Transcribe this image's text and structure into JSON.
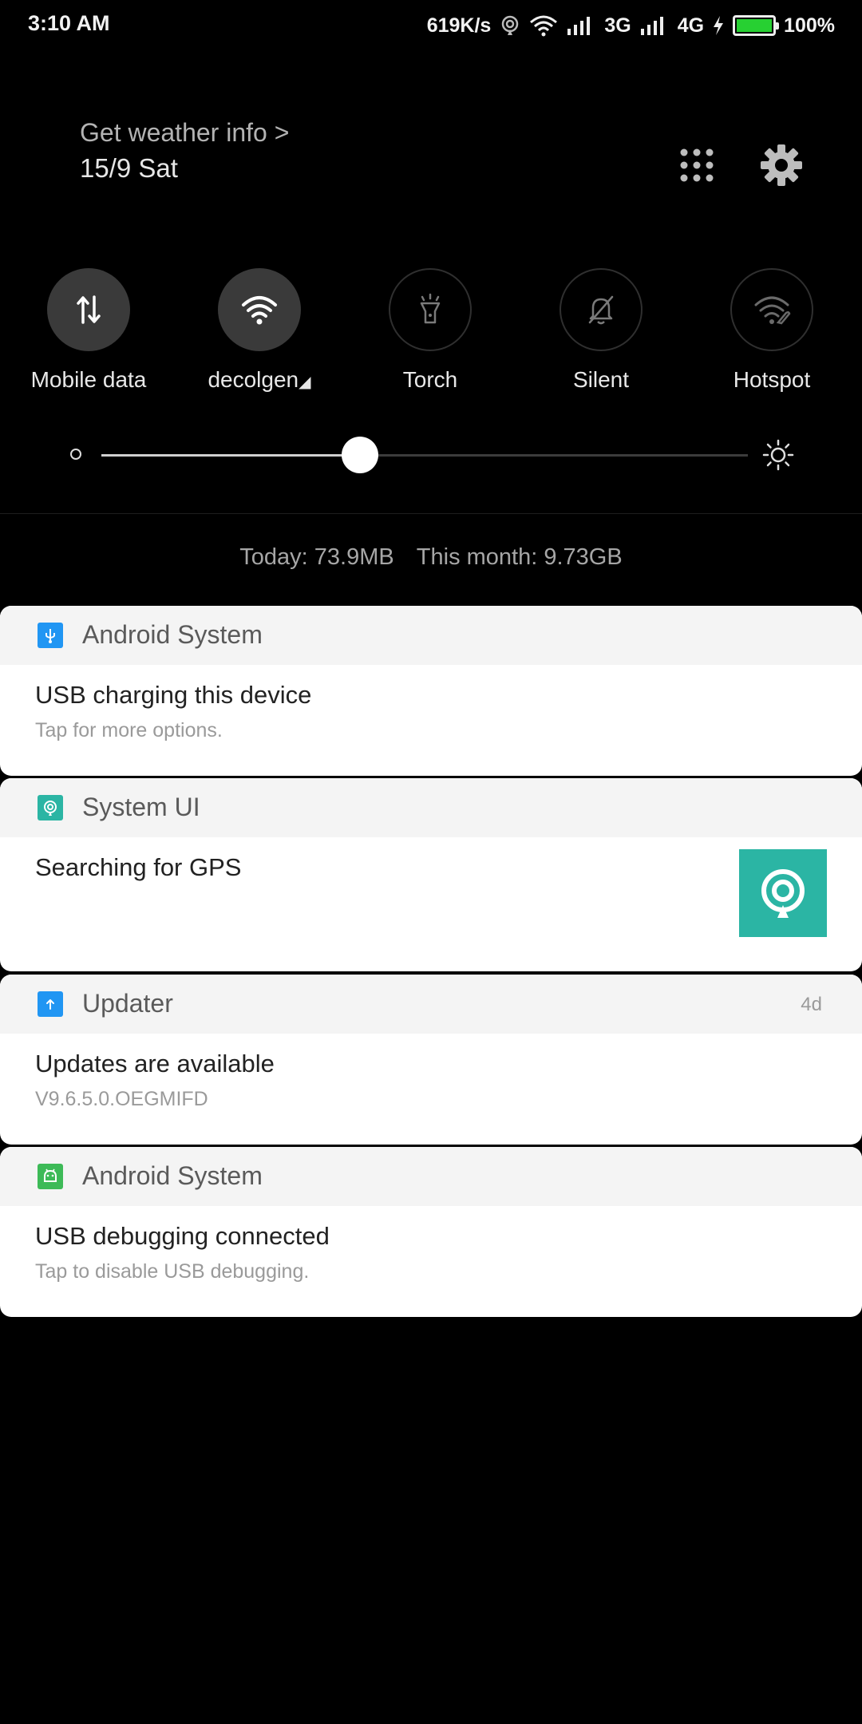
{
  "status_bar": {
    "time": "3:10 AM",
    "net_speed": "619K/s",
    "net_3g": "3G",
    "net_4g": "4G",
    "battery": "100%",
    "battery_color": "#27d032"
  },
  "header": {
    "weather": "Get weather info >",
    "date": "15/9 Sat"
  },
  "toggles": [
    {
      "label": "Mobile data",
      "on": true,
      "icon": "mobile-data-icon"
    },
    {
      "label": "decolgen",
      "on": true,
      "icon": "wifi-icon"
    },
    {
      "label": "Torch",
      "on": false,
      "icon": "torch-icon"
    },
    {
      "label": "Silent",
      "on": false,
      "icon": "silent-icon"
    },
    {
      "label": "Hotspot",
      "on": false,
      "icon": "hotspot-icon"
    }
  ],
  "brightness": {
    "level": 0.4
  },
  "data_usage": {
    "today": "Today: 73.9MB",
    "month": "This month: 9.73GB"
  },
  "notifications": [
    {
      "app": "Android System",
      "title": "USB charging this device",
      "subtitle": "Tap for more options.",
      "icon": "usb-icon",
      "icon_color": "#2196f3"
    },
    {
      "app": "System UI",
      "title": "Searching for GPS",
      "icon": "gps-icon",
      "icon_color": "#2bb5a4"
    },
    {
      "app": "Updater",
      "title": "Updates are available",
      "subtitle": "V9.6.5.0.OEGMIFD",
      "time": "4d",
      "icon": "updater-icon",
      "icon_color": "#2196f3"
    },
    {
      "app": "Android System",
      "title": "USB debugging connected",
      "subtitle": "Tap to disable USB debugging.",
      "icon": "android-icon",
      "icon_color": "#3dba57"
    }
  ]
}
